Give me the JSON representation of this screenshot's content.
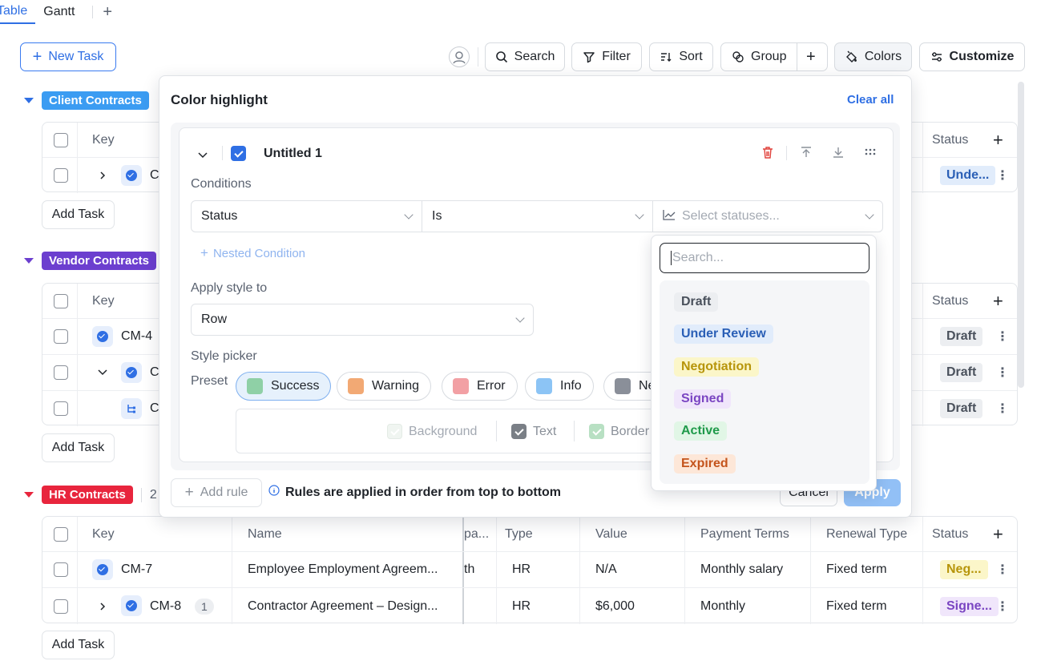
{
  "tabs": [
    {
      "label": "Table"
    },
    {
      "label": "Gantt"
    }
  ],
  "toolbar": {
    "new_task": "New Task",
    "search": "Search",
    "filter": "Filter",
    "sort": "Sort",
    "group": "Group",
    "colors": "Colors",
    "customize": "Customize"
  },
  "groups": {
    "client": {
      "label": "Client Contracts",
      "color": "#3b9cf2"
    },
    "vendor": {
      "label": "Vendor Contracts",
      "color": "#6c3fcf"
    },
    "hr": {
      "label": "HR Contracts",
      "color": "#e8253d",
      "count": "2"
    }
  },
  "columns": {
    "key": "Key",
    "name": "Name",
    "type": "Type",
    "value": "Value",
    "payment_terms": "Payment Terms",
    "renewal_type": "Renewal Type",
    "status": "Status",
    "partial_col": "pa..."
  },
  "client_rows": [
    {
      "key": "C",
      "status": "Unde..."
    }
  ],
  "vendor_rows": [
    {
      "key": "CM-4",
      "status": "Draft"
    },
    {
      "key": "C",
      "status": "Draft"
    },
    {
      "key": "C",
      "status": "Draft"
    }
  ],
  "hr_rows": [
    {
      "key": "CM-7",
      "name": "Employee Employment Agreem...",
      "partial": "th",
      "type": "HR",
      "value": "N/A",
      "payment_terms": "Monthly salary",
      "renewal_type": "Fixed term",
      "status": "Neg..."
    },
    {
      "key": "CM-8",
      "subcount": "1",
      "name": "Contractor Agreement – Design...",
      "partial": "",
      "type": "HR",
      "value": "$6,000",
      "payment_terms": "Monthly",
      "renewal_type": "Fixed term",
      "status": "Signe..."
    }
  ],
  "add_task": "Add Task",
  "modal": {
    "title": "Color highlight",
    "clear_all": "Clear all",
    "rule_name": "Untitled 1",
    "conditions_label": "Conditions",
    "field": "Status",
    "operator": "Is",
    "statuses_placeholder": "Select statuses...",
    "nested_condition": "Nested Condition",
    "apply_style_label": "Apply style to",
    "apply_style_value": "Row",
    "style_picker_label": "Style picker",
    "preset_label": "Preset",
    "presets": [
      {
        "label": "Success",
        "color": "#8fd0a6"
      },
      {
        "label": "Warning",
        "color": "#f2a974"
      },
      {
        "label": "Error",
        "color": "#f2a0a4"
      },
      {
        "label": "Info",
        "color": "#8cc4f5"
      },
      {
        "label": "Ne",
        "color": "#8a8f99"
      }
    ],
    "style_options": {
      "background": "Background",
      "text": "Text",
      "border": "Border"
    },
    "add_rule": "Add rule",
    "info_text": "Rules are applied in order from top to bottom",
    "cancel": "Cancel",
    "apply": "Apply"
  },
  "status_dropdown": {
    "search_placeholder": "Search...",
    "options": [
      {
        "label": "Draft",
        "bg": "#eceef1",
        "fg": "#4a515c"
      },
      {
        "label": "Under Review",
        "bg": "#e1ecfb",
        "fg": "#2a5fb6"
      },
      {
        "label": "Negotiation",
        "bg": "#fbf6c9",
        "fg": "#b7950b"
      },
      {
        "label": "Signed",
        "bg": "#f0e6fb",
        "fg": "#7a45c2"
      },
      {
        "label": "Active",
        "bg": "#e1f6e6",
        "fg": "#1f9a4a"
      },
      {
        "label": "Expired",
        "bg": "#fde7d8",
        "fg": "#c4541c"
      }
    ]
  }
}
